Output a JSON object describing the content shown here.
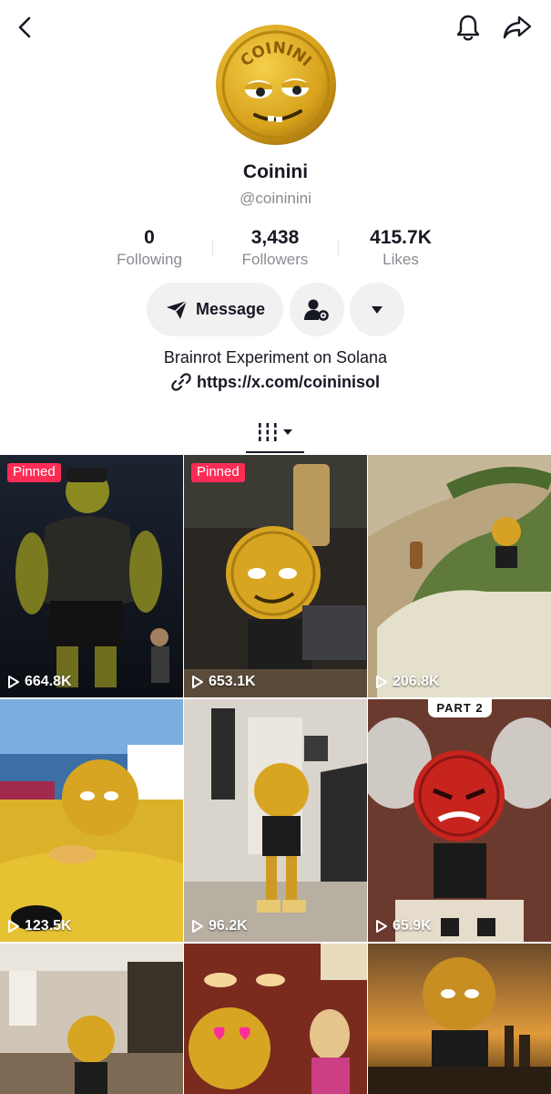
{
  "profile": {
    "display_name": "Coinini",
    "username": "@coininini",
    "avatar_text": "COININI",
    "bio": "Brainrot Experiment on Solana",
    "link": "https://x.com/coininisol"
  },
  "stats": {
    "following": {
      "value": "0",
      "label": "Following"
    },
    "followers": {
      "value": "3,438",
      "label": "Followers"
    },
    "likes": {
      "value": "415.7K",
      "label": "Likes"
    }
  },
  "actions": {
    "message_label": "Message"
  },
  "icons": {
    "back": "chevron-left-icon",
    "notifications": "bell-icon",
    "share": "share-icon",
    "message": "paper-plane-icon",
    "friend_settings": "user-gear-icon",
    "dropdown": "caret-down-icon",
    "link": "link-icon",
    "grid_tab": "grid-icon",
    "play": "play-icon"
  },
  "colors": {
    "accent": "#fe2c55",
    "text_primary": "#161823",
    "text_secondary": "#8a8b91",
    "button_bg": "#f1f1f2"
  },
  "videos": [
    {
      "views": "664.8K",
      "pinned_label": "Pinned"
    },
    {
      "views": "653.1K",
      "pinned_label": "Pinned"
    },
    {
      "views": "206.8K"
    },
    {
      "views": "123.5K"
    },
    {
      "views": "96.2K"
    },
    {
      "views": "65.9K",
      "overlay": "PART 2"
    },
    {
      "views": ""
    },
    {
      "views": ""
    },
    {
      "views": ""
    }
  ]
}
